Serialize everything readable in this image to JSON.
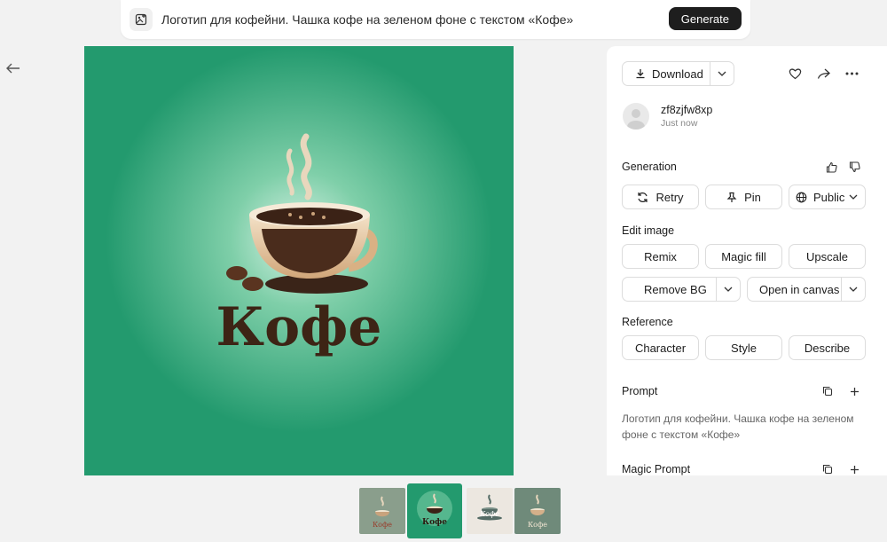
{
  "prompt_bar": {
    "text": "Логотип для кофейни. Чашка кофе на зеленом фоне с текстом «Кофе»",
    "generate_label": "Generate"
  },
  "image": {
    "logo_text": "Кофе",
    "background_color": "#239a6e"
  },
  "panel": {
    "download_label": "Download",
    "user": {
      "name": "zf8zjfw8xp",
      "time": "Just now"
    },
    "generation": {
      "title": "Generation",
      "retry_label": "Retry",
      "pin_label": "Pin",
      "visibility_label": "Public"
    },
    "edit_image": {
      "title": "Edit image",
      "remix_label": "Remix",
      "magic_fill_label": "Magic fill",
      "upscale_label": "Upscale",
      "remove_bg_label": "Remove BG",
      "open_canvas_label": "Open in canvas"
    },
    "reference": {
      "title": "Reference",
      "character_label": "Character",
      "style_label": "Style",
      "describe_label": "Describe"
    },
    "prompt": {
      "title": "Prompt",
      "text": "Логотип для кофейни. Чашка кофе на зеленом фоне с текстом «Кофе»"
    },
    "magic_prompt": {
      "title": "Magic Prompt"
    }
  },
  "thumbnails": [
    {
      "label": "Кофе",
      "bg": "#8a9e8c",
      "selected": false
    },
    {
      "label": "Кофе",
      "bg": "#239a6e",
      "selected": true
    },
    {
      "label": "Кофе",
      "bg": "#ece7e0",
      "selected": false
    },
    {
      "label": "Кофе",
      "bg": "#6f8a7a",
      "selected": false
    }
  ],
  "icons": [
    "image-prompt-icon",
    "back-arrow-icon",
    "download-icon",
    "chevron-down-icon",
    "heart-icon",
    "share-icon",
    "more-icon",
    "thumbs-up-icon",
    "thumbs-down-icon",
    "retry-icon",
    "pin-icon",
    "globe-icon",
    "copy-icon",
    "plus-icon"
  ]
}
